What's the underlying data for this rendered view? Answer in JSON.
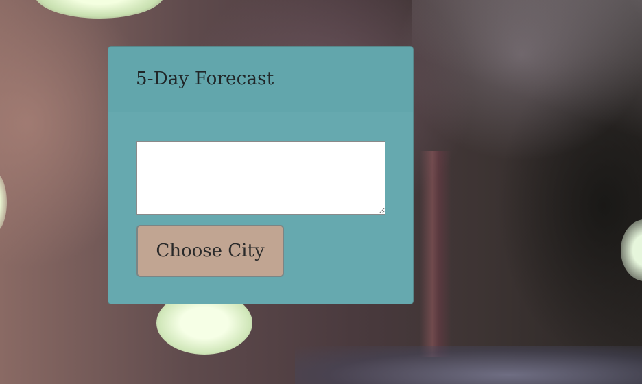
{
  "panel": {
    "title": "5-Day Forecast"
  },
  "search": {
    "value": "",
    "placeholder": ""
  },
  "actions": {
    "choose_city_label": "Choose City"
  },
  "colors": {
    "panel_background": "#66a9af",
    "button_background": "#c1a592",
    "title_text": "#202628"
  }
}
